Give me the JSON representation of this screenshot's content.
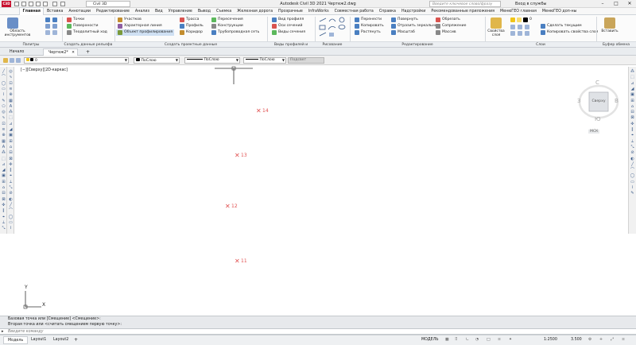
{
  "titlebar": {
    "logo": "C3D",
    "workspace": "Civil 3D",
    "title": "Autodesk Civil 3D 2021   Чертеж2.dwg",
    "search_placeholder": "Введите ключевое слово/фразу",
    "signin": "Вход в службы",
    "min": "–",
    "max": "□",
    "close": "✕"
  },
  "ribbon_tabs": [
    "Главная",
    "Вставка",
    "Аннотации",
    "Редактирование",
    "Анализ",
    "Вид",
    "Управление",
    "Вывод",
    "Съемка",
    "Железная дорога",
    "Прозрачные",
    "InfraWorks",
    "Совместная работа",
    "Справка",
    "Надстройки",
    "Рекомендованные приложения",
    "МенюГЕО главная",
    "МенюГЕО доп-ны"
  ],
  "ribbon": {
    "palettes": {
      "big": "Область инструментов",
      "title": "Палитры"
    },
    "create_ground": {
      "items": [
        "Точки",
        "Поверхности",
        "Теодолитный ход"
      ],
      "title": "Создать данные рельефа"
    },
    "create_design": {
      "items": [
        "Участков",
        "Характерная линия",
        "Объект профилирования",
        "Трасса",
        "Профиль",
        "Коридор",
        "Пересечения",
        "Конструкции",
        "Трубопроводная сеть"
      ],
      "title": "Создать проектные данные"
    },
    "profile_section": {
      "items": [
        "Вид профиля",
        "Оси сечений",
        "Виды сечения"
      ],
      "title": "Виды профилей и сечений"
    },
    "draw": {
      "title": "Рисование"
    },
    "modify": {
      "items": [
        "Перенести",
        "Повернуть",
        "Обрезать",
        "Копировать",
        "Отразить зеркально",
        "Сопряжение",
        "Растянуть",
        "Масштаб",
        "Массив"
      ],
      "title": "Редактирование"
    },
    "layers": {
      "big": "Свойства слоя",
      "layer": "0",
      "items": [
        "Сделать текущим",
        "Копировать свойства слоя"
      ],
      "title": "Слои"
    },
    "clipboard": {
      "big": "Вставить",
      "title": "Буфер обмена"
    }
  },
  "file_tabs": {
    "start": "Начало",
    "drawing": "Чертеж2*"
  },
  "properties": {
    "layer": "0",
    "color": "ПоСлою",
    "linetype": "ПоСлою",
    "lineweight": "ПоСлою",
    "transparency": "Подсвет"
  },
  "viewport_label": "[−][Сверху][2D-каркас]",
  "viewcube": {
    "north": "С",
    "south": "Ю",
    "west": "З",
    "east": "В",
    "top": "Сверху",
    "wcs": "МСК"
  },
  "markers": [
    {
      "label": "14"
    },
    {
      "label": "13"
    },
    {
      "label": "12"
    },
    {
      "label": "11"
    }
  ],
  "ucs": {
    "x": "X",
    "y": "Y"
  },
  "command": {
    "history": [
      "Базовая точка или [Смещение] <Смещение>:",
      "Вторая точка или <считать смещением первую точку>:"
    ],
    "prompt": "Введите команду"
  },
  "status": {
    "tabs": [
      "Модель",
      "Layout1",
      "Layout2"
    ],
    "add": "+",
    "model": "МОДЕЛЬ",
    "scale": "1:2500",
    "value": "3.500"
  },
  "colors": {
    "accent": "#2b5797",
    "marker": "#e05050",
    "logo": "#c8102e"
  }
}
